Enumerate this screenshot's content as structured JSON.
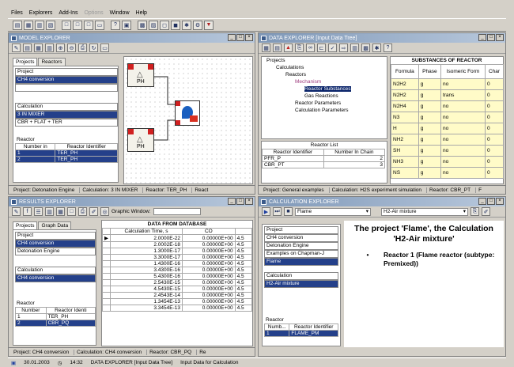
{
  "menu": [
    "Files",
    "Explorers",
    "Add-Ins",
    "Options",
    "Window",
    "Help"
  ],
  "model_explorer": {
    "title": "MODEL EXPLORER",
    "tabs": [
      "Projects",
      "Reactors"
    ],
    "project_label": "Project",
    "projects": [
      "CH4 conversion",
      "Detonation Engine"
    ],
    "calc_label": "Calculation",
    "calculations": [
      "3 IN MIXER",
      "CBR + FLAT + TER"
    ],
    "reactor_label": "Reactor",
    "reactor_headers": [
      "Number in",
      "Reactor Identifier"
    ],
    "reactors": [
      [
        "1",
        "TER_PH"
      ],
      [
        "2",
        "TER_PH"
      ]
    ],
    "node_labels": [
      "PH",
      "PH"
    ],
    "status": [
      "Project: Detonation Engine",
      "Calculation: 3 IN MIXER",
      "Reactor: TER_PH",
      "React"
    ]
  },
  "data_explorer": {
    "title": "DATA EXPLORER [Input Data Tree]",
    "tree": [
      {
        "label": "Projects",
        "level": 0
      },
      {
        "label": "Calculations",
        "level": 1
      },
      {
        "label": "Reactors",
        "level": 2
      },
      {
        "label": "Mechanism",
        "level": 3
      },
      {
        "label": "Reactor Substances",
        "level": 4
      },
      {
        "label": "Gas Reactions",
        "level": 4
      },
      {
        "label": "Reactor Parameters",
        "level": 3
      },
      {
        "label": "Calculation Parameters",
        "level": 3
      }
    ],
    "reactor_list_title": "Reactor List",
    "reactor_list_headers": [
      "Reactor Identifier",
      "Number In Chain"
    ],
    "reactor_list": [
      [
        "PFR_P",
        "2"
      ],
      [
        "CBR_PT",
        "3"
      ]
    ],
    "substances_title": "SUBSTANCES OF REACTOR",
    "substances_headers": [
      "Formula",
      "Phase",
      "Isomeric Form",
      "Char"
    ],
    "substances": [
      [
        "N2H2",
        "g",
        "no",
        "0"
      ],
      [
        "N2H2",
        "g",
        "trans",
        "0"
      ],
      [
        "N2H4",
        "g",
        "no",
        "0"
      ],
      [
        "N3",
        "g",
        "no",
        "0"
      ],
      [
        "H",
        "g",
        "no",
        "0"
      ],
      [
        "NH2",
        "g",
        "no",
        "0"
      ],
      [
        "SH",
        "g",
        "no",
        "0"
      ],
      [
        "NH3",
        "g",
        "no",
        "0"
      ],
      [
        "NS",
        "g",
        "no",
        "0"
      ]
    ],
    "status": [
      "Project: General examples",
      "Calculation: H2S experiment simulation",
      "Reactor: CBR_PT",
      "F"
    ]
  },
  "results_explorer": {
    "title": "RESULTS EXPLORER",
    "graphic_window": "Graphic Window:",
    "tabs": [
      "Projects",
      "Graph Data"
    ],
    "project_label": "Project",
    "projects": [
      "CH4 conversion",
      "Detonation Engine"
    ],
    "calc_label": "Calculation",
    "calculations": [
      "CH4 conversion"
    ],
    "reactor_label": "Reactor",
    "reactor_headers": [
      "Number",
      "Reactor Identi"
    ],
    "reactors": [
      [
        "1",
        "TER_PH"
      ],
      [
        "2",
        "CBR_PQ"
      ]
    ],
    "table_title": "DATA FROM DATABASE",
    "table_headers": [
      "Calculation Time, s",
      "CO",
      ""
    ],
    "rows": [
      [
        "2.0000E-22",
        "0.00000E+00",
        "4.5"
      ],
      [
        "2.0002E-18",
        "0.00000E+00",
        "4.5"
      ],
      [
        "1.3000E-17",
        "0.00000E+00",
        "4.5"
      ],
      [
        "3.3000E-17",
        "0.00000E+00",
        "4.5"
      ],
      [
        "1.4300E-16",
        "0.00000E+00",
        "4.5"
      ],
      [
        "3.4300E-16",
        "0.00000E+00",
        "4.5"
      ],
      [
        "5.4300E-16",
        "0.00000E+00",
        "4.5"
      ],
      [
        "2.5430E-15",
        "0.00000E+00",
        "4.5"
      ],
      [
        "4.5430E-15",
        "0.00000E+00",
        "4.5"
      ],
      [
        "2.4543E-14",
        "0.00000E+00",
        "4.5"
      ],
      [
        "1.3454E-13",
        "0.00000E+00",
        "4.5"
      ],
      [
        "3.3454E-13",
        "0.00000E+00",
        "4.5"
      ]
    ],
    "status": [
      "Project: CH4 conversion",
      "Calculation: CH4 conversion",
      "Reactor: CBR_PQ",
      "Re"
    ]
  },
  "calc_explorer": {
    "title": "CALCULATION EXPLORER",
    "dropdown1": "Flame",
    "dropdown2": "H2-Air mixture",
    "project_label": "Project",
    "projects": [
      "CH4 conversion",
      "Detonation Engine",
      "Examples on Chapman-J",
      "Flame"
    ],
    "calc_label": "Calculation",
    "calculations": [
      "H2-Air mixture"
    ],
    "reactor_label": "Reactor",
    "reactor_headers": [
      "Numb...",
      "Reactor Identifier"
    ],
    "reactors": [
      [
        "1",
        "FLAME_PM"
      ]
    ],
    "description": "The project 'Flame', the Calculation 'H2-Air mixture'",
    "bullet": "Reactor 1 (Flame reactor (subtype: Premixed))"
  },
  "taskbar": [
    "30.01.2003",
    "14:32",
    "DATA EXPLORER [Input Data Tree]",
    "Input Data for Calculation"
  ]
}
